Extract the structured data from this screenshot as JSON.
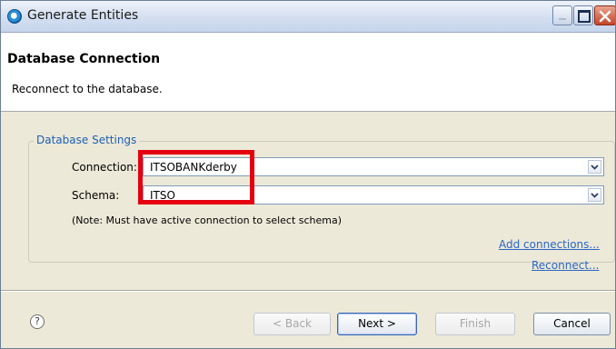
{
  "window": {
    "title": "Generate Entities",
    "icon": "app-circle-icon"
  },
  "header": {
    "title": "Database Connection",
    "description": "Reconnect to the database."
  },
  "settings": {
    "group_label": "Database Settings",
    "connection": {
      "label": "Connection:",
      "value": "ITSOBANKderby"
    },
    "schema": {
      "label": "Schema:",
      "value": "ITSO"
    },
    "note": "(Note:  Must have active connection to select schema)",
    "add_connections": "Add connections...",
    "reconnect": "Reconnect..."
  },
  "footer": {
    "help_symbol": "?",
    "back": "< Back",
    "next": "Next >",
    "finish": "Finish",
    "cancel": "Cancel"
  },
  "colors": {
    "highlight": "#e4000f",
    "link": "#2b66c7",
    "legend": "#1f5fb5"
  }
}
